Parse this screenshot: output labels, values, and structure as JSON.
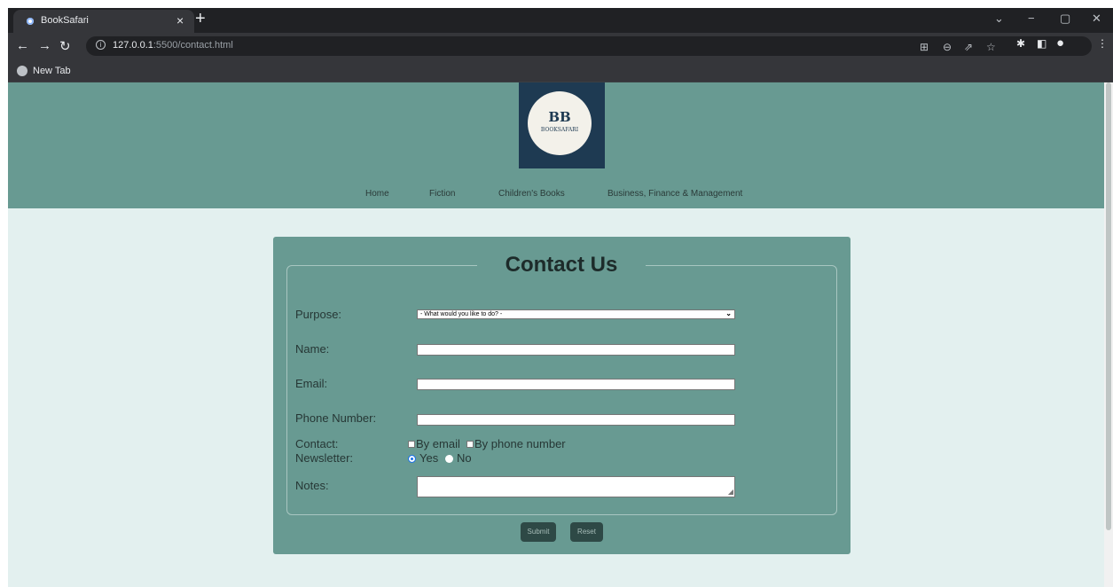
{
  "browser": {
    "tab_title": "BookSafari",
    "tab_close": "×",
    "new_tab": "+",
    "url_host": "127.0.0.1",
    "url_rest": ":5500/contact.html",
    "bookmark": "New Tab",
    "icons": [
      "back-icon",
      "forward-icon",
      "reload-icon",
      "info-icon",
      "translate-icon",
      "zoom-icon",
      "share-icon",
      "star-icon",
      "extensions-icon",
      "sidepanel-icon",
      "profile-icon",
      "menu-icon"
    ]
  },
  "site": {
    "logo_mono": "BB",
    "logo_text": "BOOKSAFARI",
    "menu": [
      "Home",
      "Fiction",
      "Children's Books",
      "Business, Finance & Management"
    ]
  },
  "form": {
    "title": "Contact Us",
    "purpose_label": "Purpose:",
    "purpose_value": "- What would you like to do? -",
    "name_label": "Name:",
    "email_label": "Email:",
    "phone_label": "Phone Number:",
    "contact_label": "Contact:",
    "contact_opt1": "By email",
    "contact_opt2": "By phone number",
    "newsletter_label": "Newsletter:",
    "newsletter_yes": "Yes",
    "newsletter_no": "No",
    "notes_label": "Notes:",
    "submit": "Submit",
    "reset": "Reset"
  }
}
